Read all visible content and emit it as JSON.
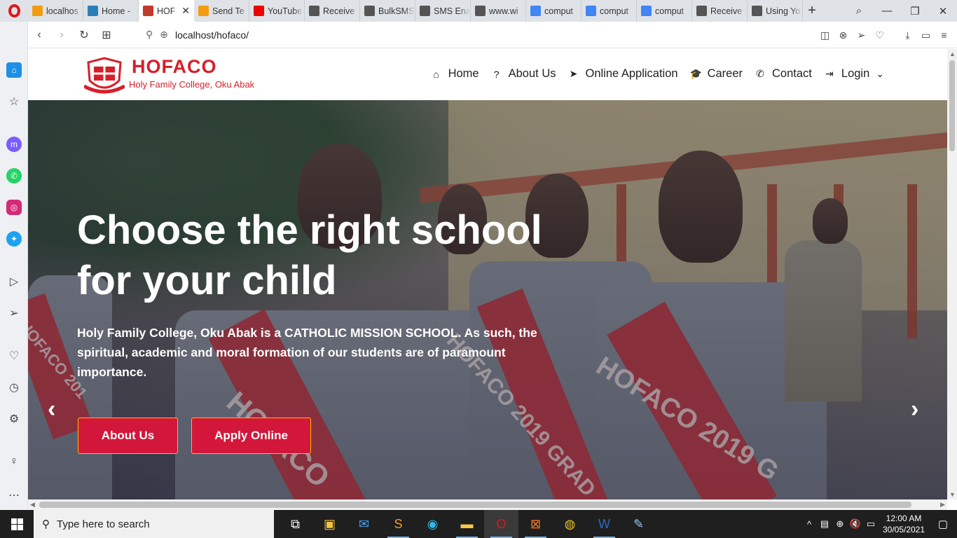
{
  "browser": {
    "tabs": [
      {
        "title": "localhos",
        "favicon": "pma-icon",
        "color": "#f39c12",
        "active": false
      },
      {
        "title": "Home -",
        "favicon": "home-icon",
        "color": "#2980b9",
        "active": false
      },
      {
        "title": "HOF",
        "favicon": "hofaco-icon",
        "color": "#c0392b",
        "active": true
      },
      {
        "title": "Send Te",
        "favicon": "smiley-icon",
        "color": "#f39c12",
        "active": false
      },
      {
        "title": "YouTube",
        "favicon": "youtube-icon",
        "color": "#e00",
        "active": false
      },
      {
        "title": "Receive",
        "favicon": "doc-icon",
        "color": "#555",
        "active": false
      },
      {
        "title": "BulkSMS",
        "favicon": "doc-icon",
        "color": "#555",
        "active": false
      },
      {
        "title": "SMS Ena",
        "favicon": "doc-icon",
        "color": "#555",
        "active": false
      },
      {
        "title": "www.wi",
        "favicon": "doc-icon",
        "color": "#555",
        "active": false
      },
      {
        "title": "comput",
        "favicon": "google-icon",
        "color": "#4285f4",
        "active": false
      },
      {
        "title": "comput",
        "favicon": "google-icon",
        "color": "#4285f4",
        "active": false
      },
      {
        "title": "comput",
        "favicon": "google-icon",
        "color": "#4285f4",
        "active": false
      },
      {
        "title": "Receive",
        "favicon": "doc-icon",
        "color": "#555",
        "active": false
      },
      {
        "title": "Using Yo",
        "favicon": "doc-icon",
        "color": "#555",
        "active": false
      }
    ],
    "url": "localhost/hofaco/"
  },
  "site": {
    "logo_name": "HOFACO",
    "logo_sub": "Holy Family College, Oku Abak",
    "nav": [
      {
        "label": "Home",
        "icon": "home-icon",
        "glyph": "⌂"
      },
      {
        "label": "About Us",
        "icon": "question-icon",
        "glyph": "?"
      },
      {
        "label": "Online Application",
        "icon": "paper-plane-icon",
        "glyph": "➤"
      },
      {
        "label": "Career",
        "icon": "graduation-cap-icon",
        "glyph": "🎓"
      },
      {
        "label": "Contact",
        "icon": "phone-icon",
        "glyph": "✆"
      },
      {
        "label": "Login",
        "icon": "sign-in-icon",
        "glyph": "⇥"
      }
    ],
    "hero": {
      "title": "Choose the right school for your child",
      "text": "Holy Family College, Oku Abak is a CATHOLIC MISSION SCHOOL. As such, the spiritual, academic and moral formation of our students are of paramount importance.",
      "btn_about": "About Us",
      "btn_apply": "Apply Online",
      "sash_text": "HOFACO",
      "sash_text_2": "HOFACO 2019 GRAD",
      "sash_text_3": "HOFACO 2019 G",
      "sash_text_4": "HOFACO 201"
    }
  },
  "taskbar": {
    "search_placeholder": "Type here to search",
    "time": "12:00 AM",
    "date": "30/05/2021"
  },
  "colors": {
    "brand_red": "#d71f2a",
    "button_red": "#d3173a",
    "button_border": "#f2c200"
  }
}
